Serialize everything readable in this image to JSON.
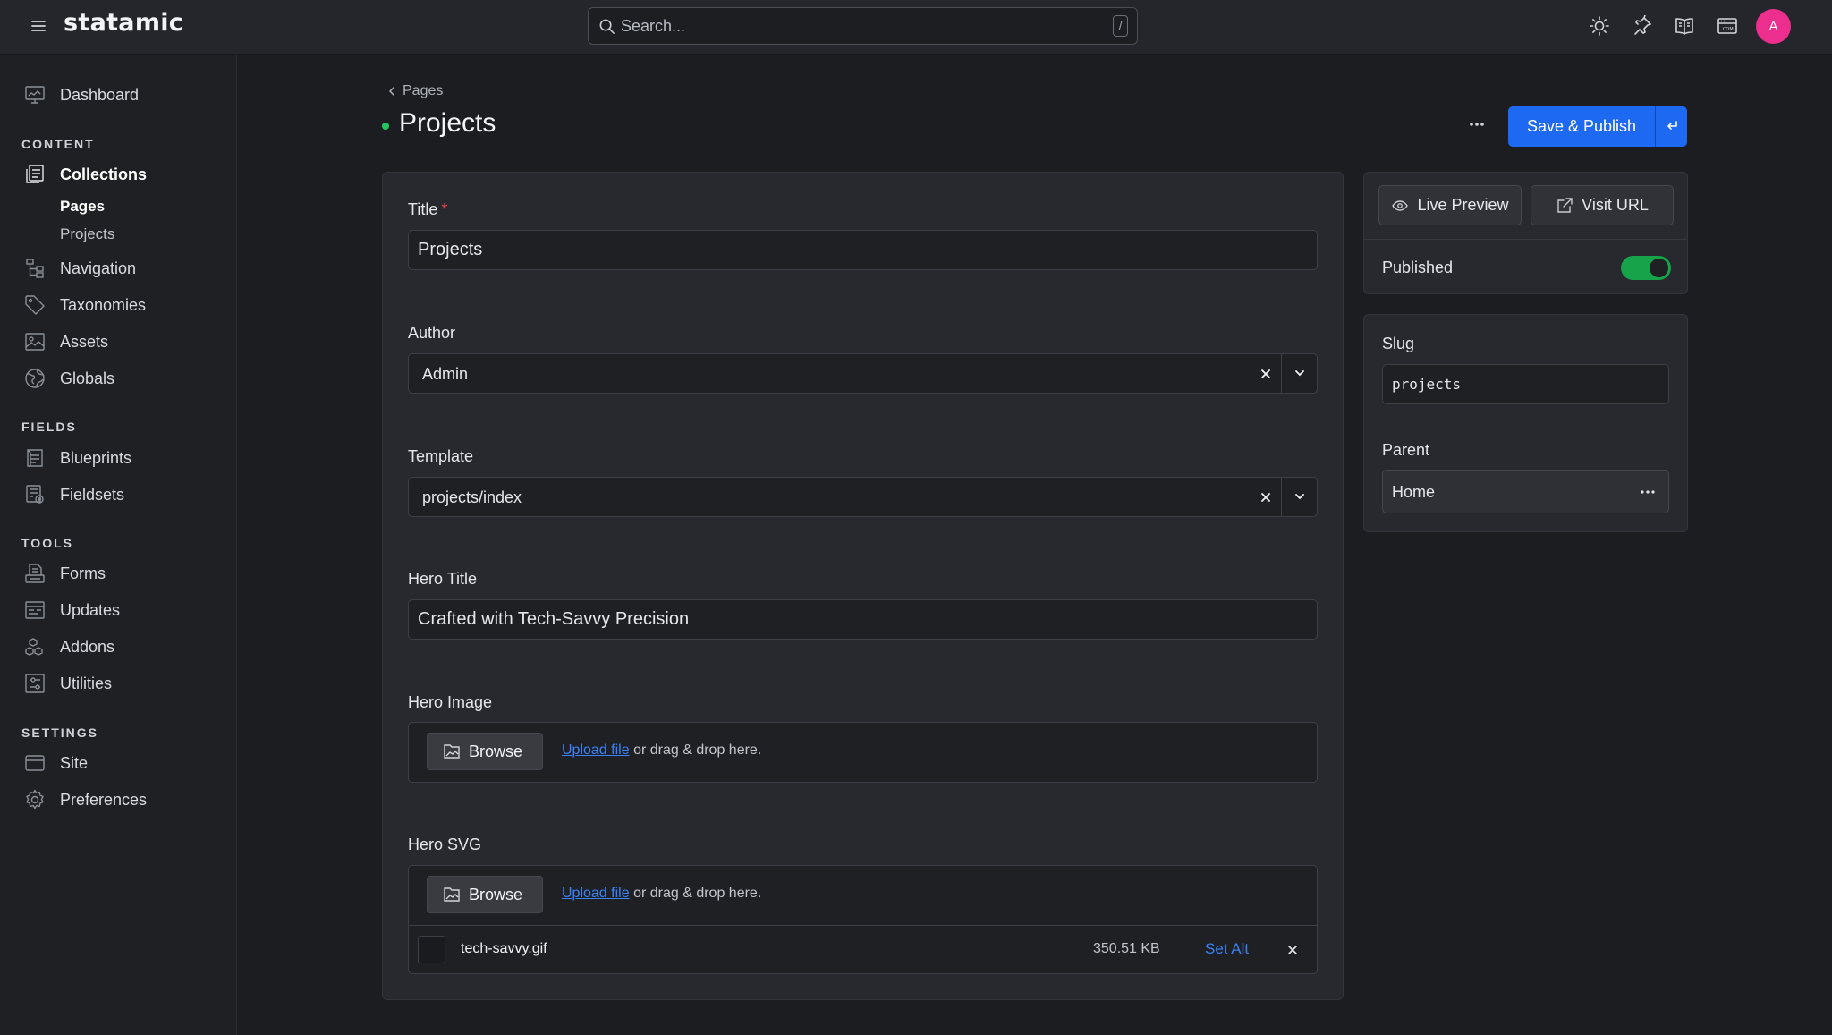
{
  "app": {
    "brand": "statamic"
  },
  "search": {
    "placeholder": "Search...",
    "shortcut": "/"
  },
  "user": {
    "initial": "A"
  },
  "sidebar": {
    "dashboard": "Dashboard",
    "sections": {
      "content": "CONTENT",
      "fields": "FIELDS",
      "tools": "TOOLS",
      "settings": "SETTINGS"
    },
    "content_items": {
      "collections": "Collections",
      "pages": "Pages",
      "projects": "Projects",
      "navigation": "Navigation",
      "taxonomies": "Taxonomies",
      "assets": "Assets",
      "globals": "Globals"
    },
    "fields_items": {
      "blueprints": "Blueprints",
      "fieldsets": "Fieldsets"
    },
    "tools_items": {
      "forms": "Forms",
      "updates": "Updates",
      "addons": "Addons",
      "utilities": "Utilities"
    },
    "settings_items": {
      "site": "Site",
      "preferences": "Preferences"
    }
  },
  "header": {
    "breadcrumb": "Pages",
    "title": "Projects",
    "save_label": "Save & Publish"
  },
  "form": {
    "title": {
      "label": "Title",
      "value": "Projects"
    },
    "author": {
      "label": "Author",
      "value": "Admin"
    },
    "template": {
      "label": "Template",
      "value": "projects/index"
    },
    "hero_title": {
      "label": "Hero Title",
      "value": "Crafted with Tech-Savvy Precision"
    },
    "hero_image": {
      "label": "Hero Image"
    },
    "hero_svg": {
      "label": "Hero SVG",
      "file": {
        "name": "tech-savvy.gif",
        "size": "350.51 KB",
        "set_alt": "Set Alt"
      }
    },
    "uploader": {
      "browse": "Browse",
      "upload_link": "Upload file",
      "hint": "or drag & drop here."
    }
  },
  "sidepanel": {
    "live_preview": "Live Preview",
    "visit_url": "Visit URL",
    "published_label": "Published",
    "published": true,
    "slug_label": "Slug",
    "slug_value": "projects",
    "parent_label": "Parent",
    "parent_value": "Home"
  },
  "colors": {
    "accent": "#1d69f2",
    "published_green": "#16a34a",
    "status_dot": "#22c55e",
    "avatar": "#ec2f8f",
    "link": "#3b82f6",
    "required": "#ef4444"
  }
}
